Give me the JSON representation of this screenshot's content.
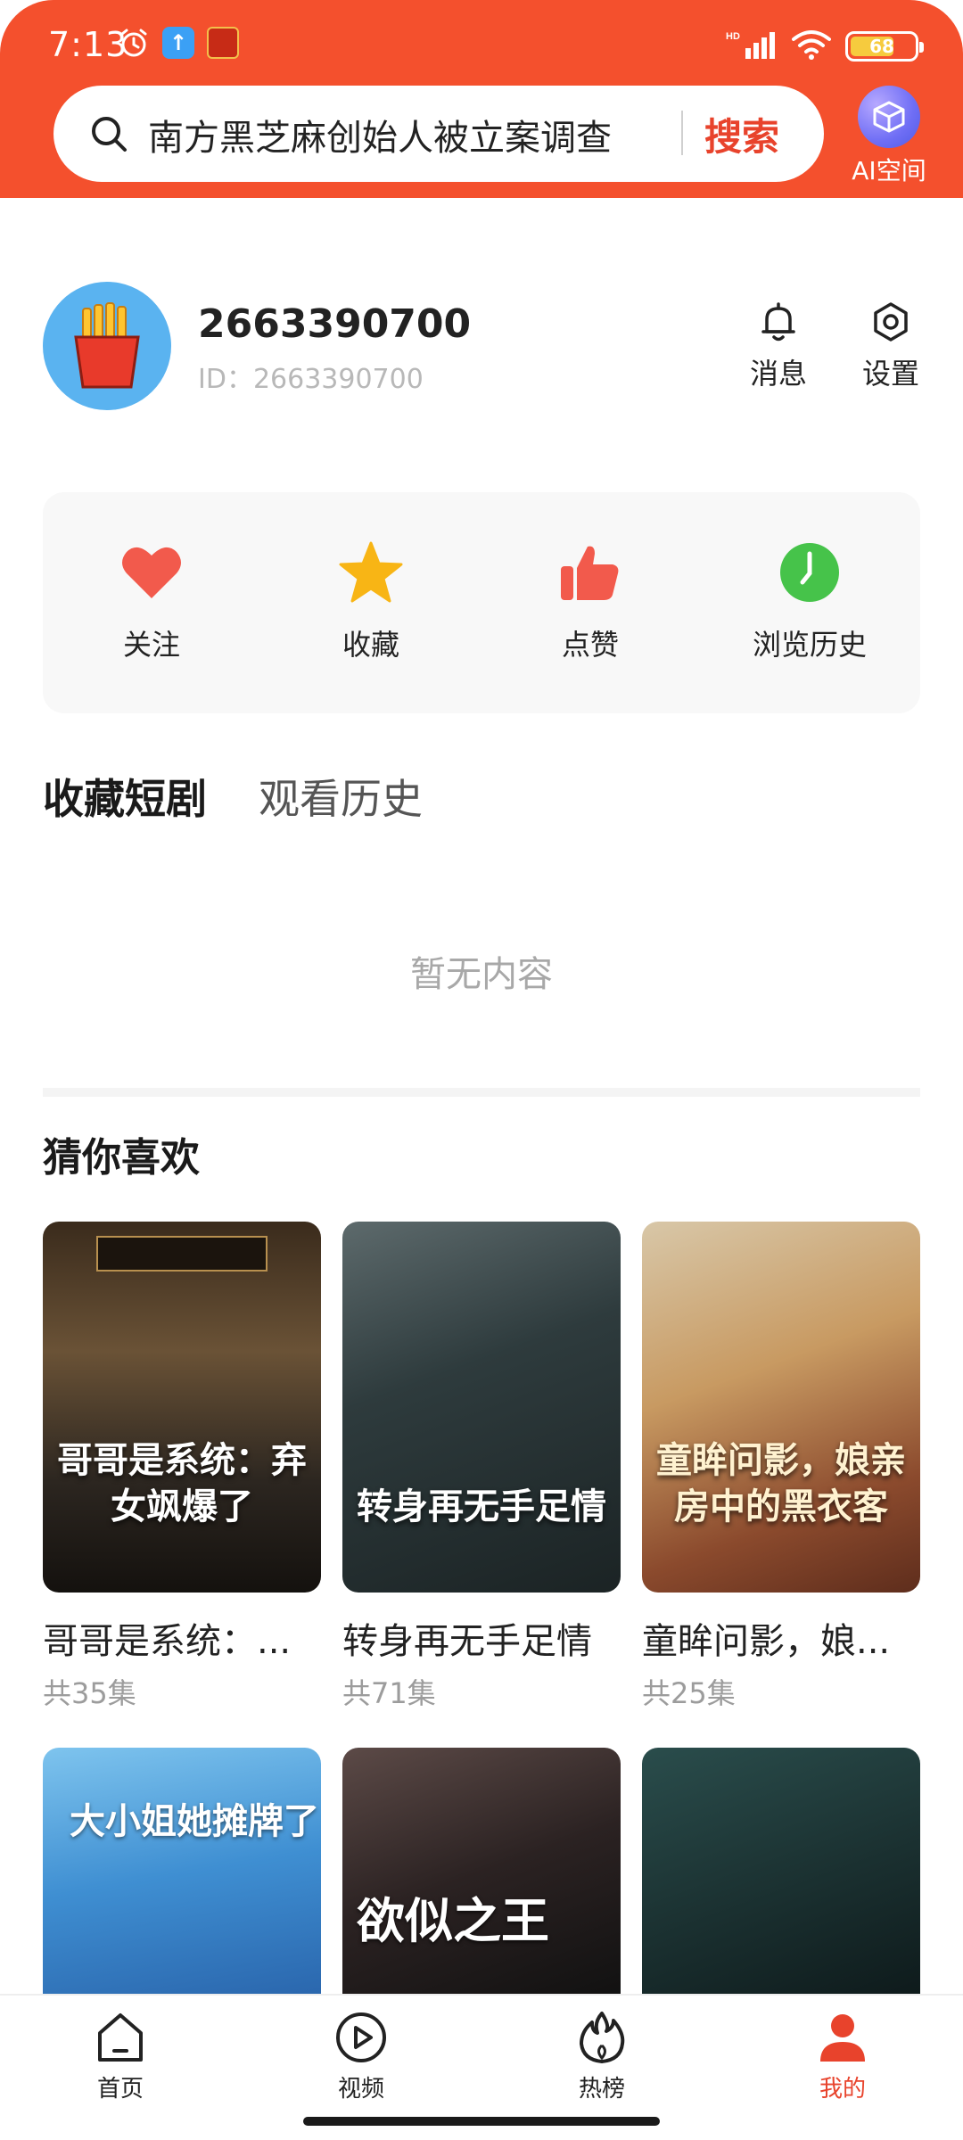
{
  "status_bar": {
    "time": "7:13",
    "network": "HD",
    "battery": "68",
    "battery_level": 0.68
  },
  "search": {
    "query": "南方黑芝麻创始人被立案调查",
    "button_label": "搜索"
  },
  "ai_space": {
    "label": "AI空间"
  },
  "profile": {
    "username": "2663390700",
    "id_text": "ID：2663390700",
    "messages_label": "消息",
    "settings_label": "设置"
  },
  "quick_actions": [
    {
      "label": "关注",
      "icon": "heart-icon",
      "color": "#f25a4c"
    },
    {
      "label": "收藏",
      "icon": "star-icon",
      "color": "#f8b515"
    },
    {
      "label": "点赞",
      "icon": "thumbs-up-icon",
      "color": "#f25a4c"
    },
    {
      "label": "浏览历史",
      "icon": "clock-icon",
      "color": "#46c34a"
    }
  ],
  "tabs": {
    "active": "收藏短剧",
    "inactive": "观看历史"
  },
  "empty_state": "暂无内容",
  "recommend": {
    "title": "猜你喜欢",
    "items": [
      {
        "poster_text": "哥哥是系统：弃女飒爆了",
        "name": "哥哥是系统：...",
        "episodes": "共35集"
      },
      {
        "poster_text": "转身再无手足情",
        "name": "转身再无手足情",
        "episodes": "共71集"
      },
      {
        "poster_text": "童眸问影，娘亲房中的黑衣客",
        "name": "童眸问影，娘...",
        "episodes": "共25集"
      },
      {
        "poster_text": "大小姐她摊牌了"
      },
      {
        "poster_text": "欲似之王"
      },
      {
        "poster_text": ""
      }
    ]
  },
  "bottom_nav": [
    {
      "label": "首页",
      "icon": "home-icon"
    },
    {
      "label": "视频",
      "icon": "play-circle-icon"
    },
    {
      "label": "热榜",
      "icon": "flame-icon"
    },
    {
      "label": "我的",
      "icon": "person-icon"
    }
  ],
  "colors": {
    "brand": "#f4502d",
    "accent_red": "#e8432c",
    "avatar_bg": "#5ab3f0"
  }
}
